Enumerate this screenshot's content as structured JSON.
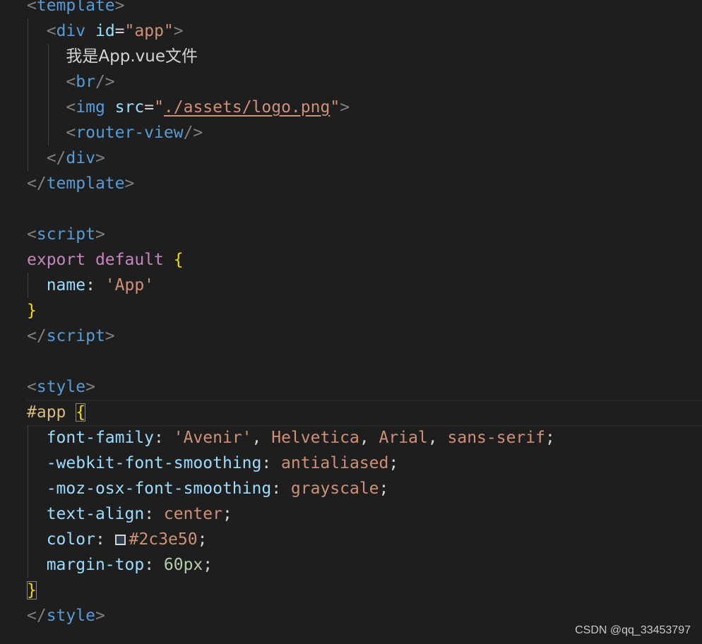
{
  "code": {
    "template_open": "template",
    "div_tag": "div",
    "div_id_attr": "id",
    "div_id_value": "\"app\"",
    "body_text": "我是App.vue文件",
    "br_tag": "br",
    "img_tag": "img",
    "img_src_attr": "src",
    "img_src_value": "./assets/logo.png",
    "router_view_tag": "router-view",
    "div_close": "div",
    "template_close": "template",
    "script_open": "script",
    "export_kw": "export",
    "default_kw": "default",
    "name_prop": "name",
    "name_value": "'App'",
    "script_close": "script",
    "style_open": "style",
    "selector": "#app",
    "font_family_prop": "font-family",
    "font_family_values": [
      "'Avenir'",
      "Helvetica",
      "Arial",
      "sans-serif"
    ],
    "webkit_prop": "-webkit-font-smoothing",
    "webkit_value": "antialiased",
    "moz_prop": "-moz-osx-font-smoothing",
    "moz_value": "grayscale",
    "text_align_prop": "text-align",
    "text_align_value": "center",
    "color_prop": "color",
    "color_value": "#2c3e50",
    "color_swatch": "#2c3e50",
    "margin_top_prop": "margin-top",
    "margin_top_value": "60px",
    "style_close": "style"
  },
  "watermark": "CSDN @qq_33453797"
}
